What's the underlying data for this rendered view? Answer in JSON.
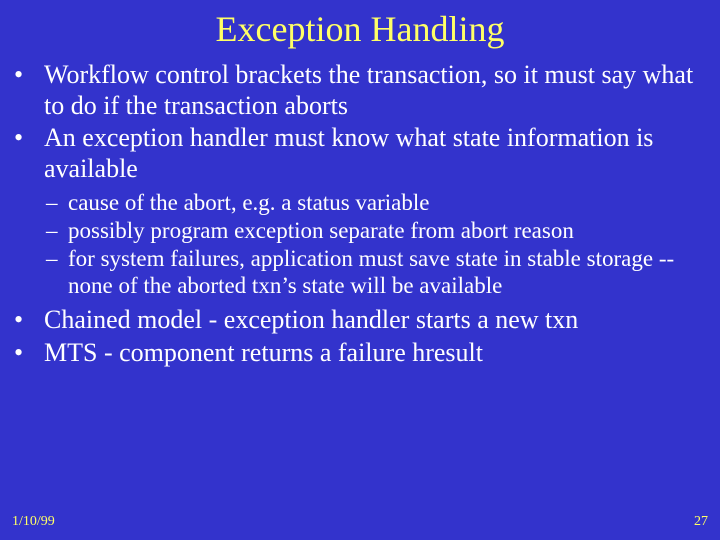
{
  "title": "Exception Handling",
  "bullets": [
    {
      "text": "Workflow control brackets the transaction, so it must say what to do if the transaction aborts",
      "sub": []
    },
    {
      "text": "An exception handler must know what state information is available",
      "sub": [
        "cause of the abort, e.g. a status variable",
        "possibly program exception separate from abort reason",
        "for system failures, application must save state in stable storage -- none of the aborted txn’s state will be available"
      ]
    },
    {
      "text": "Chained model - exception handler starts a new txn",
      "sub": []
    },
    {
      "text": "MTS - component returns a failure hresult",
      "sub": []
    }
  ],
  "footer": {
    "date": "1/10/99",
    "page": "27"
  }
}
